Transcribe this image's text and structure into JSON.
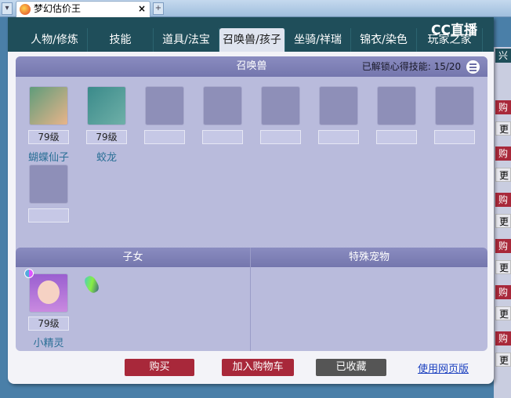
{
  "browser": {
    "tab_title": "梦幻估价王",
    "close": "×",
    "new_tab": "+",
    "menu": "▾"
  },
  "logo": "CC直播",
  "nav_tabs": [
    {
      "label": "人物/修炼"
    },
    {
      "label": "技能"
    },
    {
      "label": "道具/法宝"
    },
    {
      "label": "召唤兽/孩子",
      "active": true
    },
    {
      "label": "坐骑/祥瑞"
    },
    {
      "label": "锦衣/染色"
    },
    {
      "label": "玩家之家"
    }
  ],
  "summon": {
    "title": "召唤兽",
    "unlock_label": "已解锁心得技能:",
    "unlock_value": "15/20",
    "pets": [
      {
        "level": "79级",
        "name": "蝴蝶仙子"
      },
      {
        "level": "79级",
        "name": "蛟龙"
      }
    ]
  },
  "children": {
    "title": "子女",
    "items": [
      {
        "level": "79级",
        "name": "小精灵"
      }
    ]
  },
  "special": {
    "title": "特殊宠物"
  },
  "actions": {
    "buy": "购买",
    "add_cart": "加入购物车",
    "favorited": "已收藏",
    "web_version": "使用网页版"
  },
  "background": {
    "red_btn": "购",
    "gray_btn": "更",
    "top": "兴"
  },
  "colors": {
    "accent_red": "#a8283a",
    "teal": "#1f4e5a",
    "panel": "#b9bbdc"
  }
}
